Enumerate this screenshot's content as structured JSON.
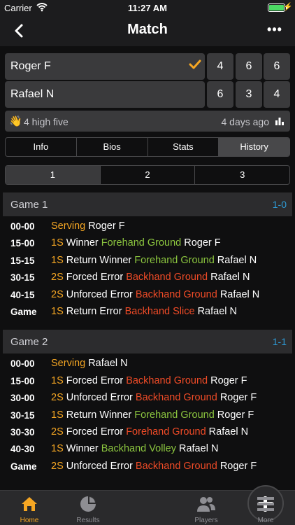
{
  "status": {
    "carrier": "Carrier",
    "time": "11:27 AM"
  },
  "nav": {
    "title": "Match",
    "more": "•••"
  },
  "players": [
    {
      "name": "Roger F",
      "winner": true,
      "sets": [
        "4",
        "6",
        "6"
      ]
    },
    {
      "name": "Rafael N",
      "winner": false,
      "sets": [
        "6",
        "3",
        "4"
      ]
    }
  ],
  "hi5": {
    "text": "4 high five",
    "ago": "4 days ago"
  },
  "tabs": [
    "Info",
    "Bios",
    "Stats",
    "History"
  ],
  "active_tab": "History",
  "set_tabs": [
    "1",
    "2",
    "3"
  ],
  "active_set": "1",
  "games": [
    {
      "name": "Game 1",
      "score": "1-0",
      "points": [
        {
          "score": "00-00",
          "parts": [
            {
              "t": "Serving",
              "c": "y"
            },
            {
              "t": " Roger F",
              "c": "w"
            }
          ]
        },
        {
          "score": "15-00",
          "parts": [
            {
              "t": "1S",
              "c": "y"
            },
            {
              "t": " Winner ",
              "c": "w"
            },
            {
              "t": "Forehand Ground",
              "c": "g"
            },
            {
              "t": " Roger F",
              "c": "w"
            }
          ]
        },
        {
          "score": "15-15",
          "parts": [
            {
              "t": "1S",
              "c": "y"
            },
            {
              "t": " Return Winner ",
              "c": "w"
            },
            {
              "t": "Forehand Ground",
              "c": "g"
            },
            {
              "t": " Rafael N",
              "c": "w"
            }
          ]
        },
        {
          "score": "30-15",
          "parts": [
            {
              "t": "2S",
              "c": "y"
            },
            {
              "t": " Forced Error ",
              "c": "w"
            },
            {
              "t": "Backhand Ground",
              "c": "r"
            },
            {
              "t": " Rafael N",
              "c": "w"
            }
          ]
        },
        {
          "score": "40-15",
          "parts": [
            {
              "t": "2S",
              "c": "y"
            },
            {
              "t": " Unforced Error ",
              "c": "w"
            },
            {
              "t": "Backhand Ground",
              "c": "r"
            },
            {
              "t": " Rafael N",
              "c": "w"
            }
          ]
        },
        {
          "score": "Game",
          "parts": [
            {
              "t": "1S",
              "c": "y"
            },
            {
              "t": " Return Error ",
              "c": "w"
            },
            {
              "t": "Backhand Slice",
              "c": "r"
            },
            {
              "t": " Rafael N",
              "c": "w"
            }
          ]
        }
      ]
    },
    {
      "name": "Game 2",
      "score": "1-1",
      "points": [
        {
          "score": "00-00",
          "parts": [
            {
              "t": "Serving",
              "c": "y"
            },
            {
              "t": " Rafael N",
              "c": "w"
            }
          ]
        },
        {
          "score": "15-00",
          "parts": [
            {
              "t": "1S",
              "c": "y"
            },
            {
              "t": " Forced Error ",
              "c": "w"
            },
            {
              "t": "Backhand Ground",
              "c": "r"
            },
            {
              "t": " Roger F",
              "c": "w"
            }
          ]
        },
        {
          "score": "30-00",
          "parts": [
            {
              "t": "2S",
              "c": "y"
            },
            {
              "t": " Unforced Error ",
              "c": "w"
            },
            {
              "t": "Backhand Ground",
              "c": "r"
            },
            {
              "t": " Roger F",
              "c": "w"
            }
          ]
        },
        {
          "score": "30-15",
          "parts": [
            {
              "t": "1S",
              "c": "y"
            },
            {
              "t": " Return Winner ",
              "c": "w"
            },
            {
              "t": "Forehand Ground",
              "c": "g"
            },
            {
              "t": " Roger F",
              "c": "w"
            }
          ]
        },
        {
          "score": "30-30",
          "parts": [
            {
              "t": "2S",
              "c": "y"
            },
            {
              "t": " Forced Error ",
              "c": "w"
            },
            {
              "t": "Forehand Ground",
              "c": "r"
            },
            {
              "t": " Rafael N",
              "c": "w"
            }
          ]
        },
        {
          "score": "40-30",
          "parts": [
            {
              "t": "1S",
              "c": "y"
            },
            {
              "t": " Winner ",
              "c": "w"
            },
            {
              "t": "Backhand Volley",
              "c": "g"
            },
            {
              "t": " Rafael N",
              "c": "w"
            }
          ]
        },
        {
          "score": "Game",
          "parts": [
            {
              "t": "2S",
              "c": "y"
            },
            {
              "t": " Unforced Error ",
              "c": "w"
            },
            {
              "t": "Backhand Ground",
              "c": "r"
            },
            {
              "t": " Roger F",
              "c": "w"
            }
          ]
        }
      ]
    }
  ],
  "tabbar": [
    {
      "label": "Home",
      "icon": "home-icon",
      "active": true
    },
    {
      "label": "Results",
      "icon": "pie-chart-icon",
      "active": false
    },
    {
      "label": "",
      "icon": "plus-icon",
      "active": false
    },
    {
      "label": "Players",
      "icon": "players-icon",
      "active": false
    },
    {
      "label": "More",
      "icon": "menu-icon",
      "active": false
    }
  ],
  "colors": {
    "accent": "#f5a623",
    "win": "#8cc63f",
    "error": "#ef4b27",
    "score": "#2e9bd6"
  }
}
